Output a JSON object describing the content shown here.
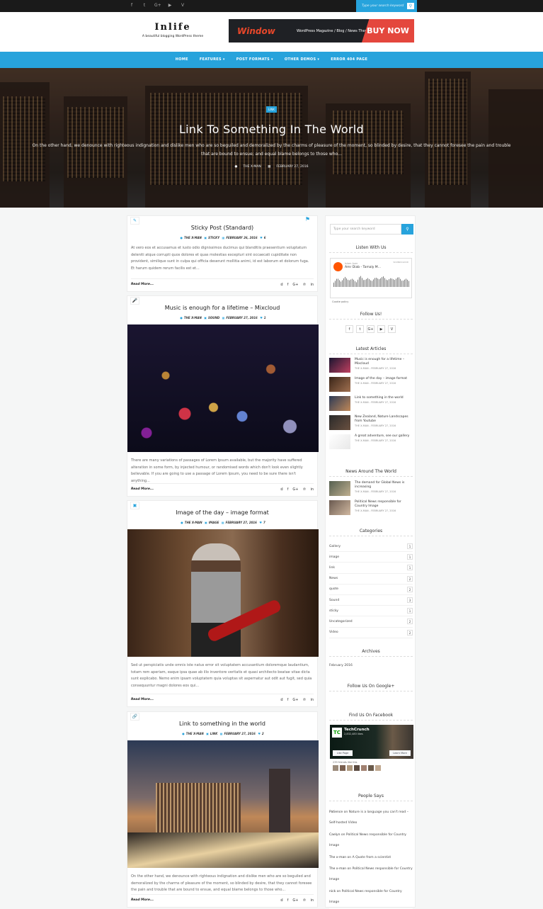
{
  "topbar": {
    "social": [
      "f",
      "t",
      "G+",
      "▶",
      "V"
    ],
    "search_placeholder": "Type your search keyword"
  },
  "header": {
    "logo_title": "Inlife",
    "logo_tagline": "A beautiful blogging WordPress theme",
    "banner": {
      "word": "Window",
      "subtitle": "WordPress Magazine / Blog / News Theme",
      "cta": "BUY NOW"
    }
  },
  "nav": {
    "items": [
      "HOME",
      "FEATURES ▾",
      "POST FORMATS ▾",
      "OTHER DEMOS ▾",
      "ERROR 404 PAGE"
    ]
  },
  "hero": {
    "badge": "LINK",
    "title": "Link To Something In The World",
    "excerpt": "On the other hand, we denounce with righteous indignation and dislike men who are so beguiled and demoralized by the charms of pleasure of the moment, so blinded by desire, that they cannot foresee the pain and trouble that are bound to ensue; and equal blame belongs to those who...",
    "author": "THE X-MAN",
    "date": "FEBRUARY 27, 2016"
  },
  "posts": [
    {
      "format_icon": "pencil-icon",
      "title": "Sticky Post (Standard)",
      "author": "THE X-MAN",
      "category": "STICKY",
      "date": "FEBRUARY 26, 2016",
      "comments": "6",
      "excerpt": "At vero eos et accusamus et iusto odio dignissimos ducimus qui blanditiis praesentium voluptatum deleniti atque corrupti quos dolores et quas molestias excepturi sint occaecati cupiditate non provident, similique sunt in culpa qui officia deserunt mollitia animi, id est laborum et dolorum fuga. Et harum quidem rerum facilis est et...",
      "read_more": "Read More..."
    },
    {
      "format_icon": "microphone-icon",
      "title": "Music is enough for a lifetime – Mixcloud",
      "author": "THE X-MAN",
      "category": "SOUND",
      "date": "FEBRUARY 27, 2016",
      "comments": "1",
      "excerpt": "There are many variations of passages of Lorem Ipsum available, but the majority have suffered alteration in some form, by injected humour, or randomised words which don't look even slightly believable. If you are going to use a passage of Lorem Ipsum, you need to be sure there isn't anything...",
      "read_more": "Read More..."
    },
    {
      "format_icon": "image-icon",
      "title": "Image of the day – image format",
      "author": "THE X-MAN",
      "category": "IMAGE",
      "date": "FEBRUARY 27, 2016",
      "comments": "7",
      "excerpt": "Sed ut perspiciatis unde omnis iste natus error sit voluptatem accusantium doloremque laudantium, totam rem aperiam, eaque ipsa quae ab illo inventore veritatis et quasi architecto beatae vitae dicta sunt explicabo. Nemo enim ipsam voluptatem quia voluptas sit aspernatur aut odit aut fugit, sed quia consequuntur magni dolores eos qui...",
      "read_more": "Read More..."
    },
    {
      "format_icon": "link-icon",
      "title": "Link to something in the world",
      "author": "THE X-MAN",
      "category": "LINK",
      "date": "FEBRUARY 27, 2016",
      "comments": "2",
      "excerpt": "On the other hand, we denounce with righteous indignation and dislike men who are so beguiled and demoralized by the charms of pleasure of the moment, so blinded by desire, that they cannot foresee the pain and trouble that are bound to ensue, and equal blame belongs to those who...",
      "read_more": "Read More..."
    }
  ],
  "share_icons": [
    "𝒕",
    "f",
    "G+",
    "℗",
    "in"
  ],
  "sidebar": {
    "search_placeholder": "Type your search keyword",
    "listen_title": "Listen With Us",
    "soundcloud": {
      "user": "Islam Azer",
      "track": "Amr Diab - Tamaly M...",
      "logo": "SOUNDCLOUD",
      "policy": "Cookie policy"
    },
    "follow_title": "Follow Us!",
    "follow_icons": [
      "f",
      "t",
      "G+",
      "▶",
      "V"
    ],
    "latest_title": "Latest Articles",
    "latest": [
      {
        "title": "Music is enough for a lifetime – Mixcloud",
        "meta": "THE X-MAN - FEBRUARY 27, 2016"
      },
      {
        "title": "Image of the day – image format",
        "meta": "THE X-MAN - FEBRUARY 27, 2016"
      },
      {
        "title": "Link to something in the world",
        "meta": "THE X-MAN - FEBRUARY 27, 2016"
      },
      {
        "title": "New Zealand, Nature Landscapes from Youtube",
        "meta": "THE X-MAN - FEBRUARY 27, 2016"
      },
      {
        "title": "A great adventure, see our gallery",
        "meta": "THE X-MAN - FEBRUARY 27, 2016"
      }
    ],
    "news_title": "News Around The World",
    "news": [
      {
        "title": "The demand for Global News is increasing",
        "meta": "THE X-MAN - FEBRUARY 27, 2016"
      },
      {
        "title": "Political News responsible for Country Image",
        "meta": "THE X-MAN - FEBRUARY 27, 2016"
      }
    ],
    "categories_title": "Categories",
    "categories": [
      {
        "name": "Gallery",
        "count": "1"
      },
      {
        "name": "image",
        "count": "1"
      },
      {
        "name": "link",
        "count": "1"
      },
      {
        "name": "News",
        "count": "2"
      },
      {
        "name": "quote",
        "count": "2"
      },
      {
        "name": "Sound",
        "count": "3"
      },
      {
        "name": "sticky",
        "count": "1"
      },
      {
        "name": "Uncategorized",
        "count": "2"
      },
      {
        "name": "Video",
        "count": "2"
      }
    ],
    "archives_title": "Archives",
    "archives": [
      "February 2016"
    ],
    "google_title": "Follow Us On Google+",
    "facebook_title": "Find Us On Facebook",
    "facebook": {
      "logo": "TC",
      "name": "TechCrunch",
      "likes": "2,832,483 likes",
      "like_page": "Like Page",
      "learn_more": "Learn More",
      "friends": "239 friends like this"
    },
    "people_title": "People Says",
    "people": [
      {
        "author": "Patience",
        "on": "on",
        "post": "Nature is a language you can't read – Self-hosted Video"
      },
      {
        "author": "Caelyn",
        "on": "on",
        "post": "Political News responsible for Country Image"
      },
      {
        "author": "The x-man",
        "on": "on",
        "post": "A Quote from a scientist"
      },
      {
        "author": "The x-man",
        "on": "on",
        "post": "Political News responsible for Country Image"
      },
      {
        "author": "nick",
        "on": "on",
        "post": "Political News responsible for Country Image"
      }
    ]
  },
  "colors": {
    "accent": "#27a3dc",
    "topbar": "#1a1a1a",
    "banner_cta": "#e4473d"
  }
}
